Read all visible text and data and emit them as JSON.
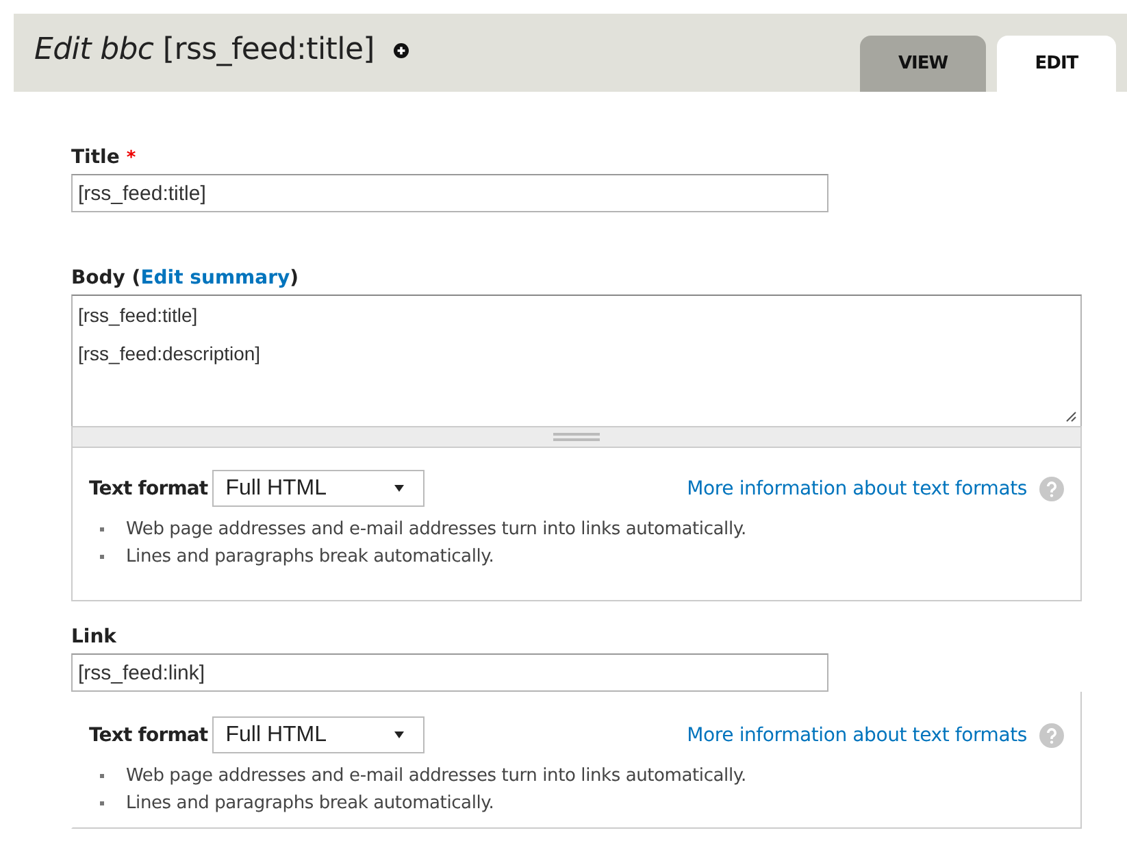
{
  "header": {
    "title_italic": "Edit bbc",
    "title_rest": "[rss_feed:title]"
  },
  "tabs": [
    {
      "label": "VIEW",
      "selected": false
    },
    {
      "label": "EDIT",
      "selected": true
    }
  ],
  "fields": [
    {
      "kind": "input",
      "label": "Title",
      "required_mark": "*",
      "value": "[rss_feed:title]"
    },
    {
      "kind": "textarea",
      "label": "Body (",
      "link": "Edit summary",
      "label_end": ")",
      "lines": [
        "[rss_feed:title]",
        "[rss_feed:description]"
      ],
      "format": {
        "label": "Text format",
        "selected": "Full HTML",
        "help_link": "More information about text formats",
        "tips": [
          "Web page addresses and e-mail addresses turn into links automatically.",
          "Lines and paragraphs break automatically."
        ]
      }
    },
    {
      "kind": "input",
      "label": "Link",
      "value": "[rss_feed:link]",
      "format": {
        "label": "Text format",
        "selected": "Full HTML",
        "help_link": "More information about text formats",
        "tips": [
          "Web page addresses and e-mail addresses turn into links automatically.",
          "Lines and paragraphs break automatically."
        ]
      }
    }
  ]
}
